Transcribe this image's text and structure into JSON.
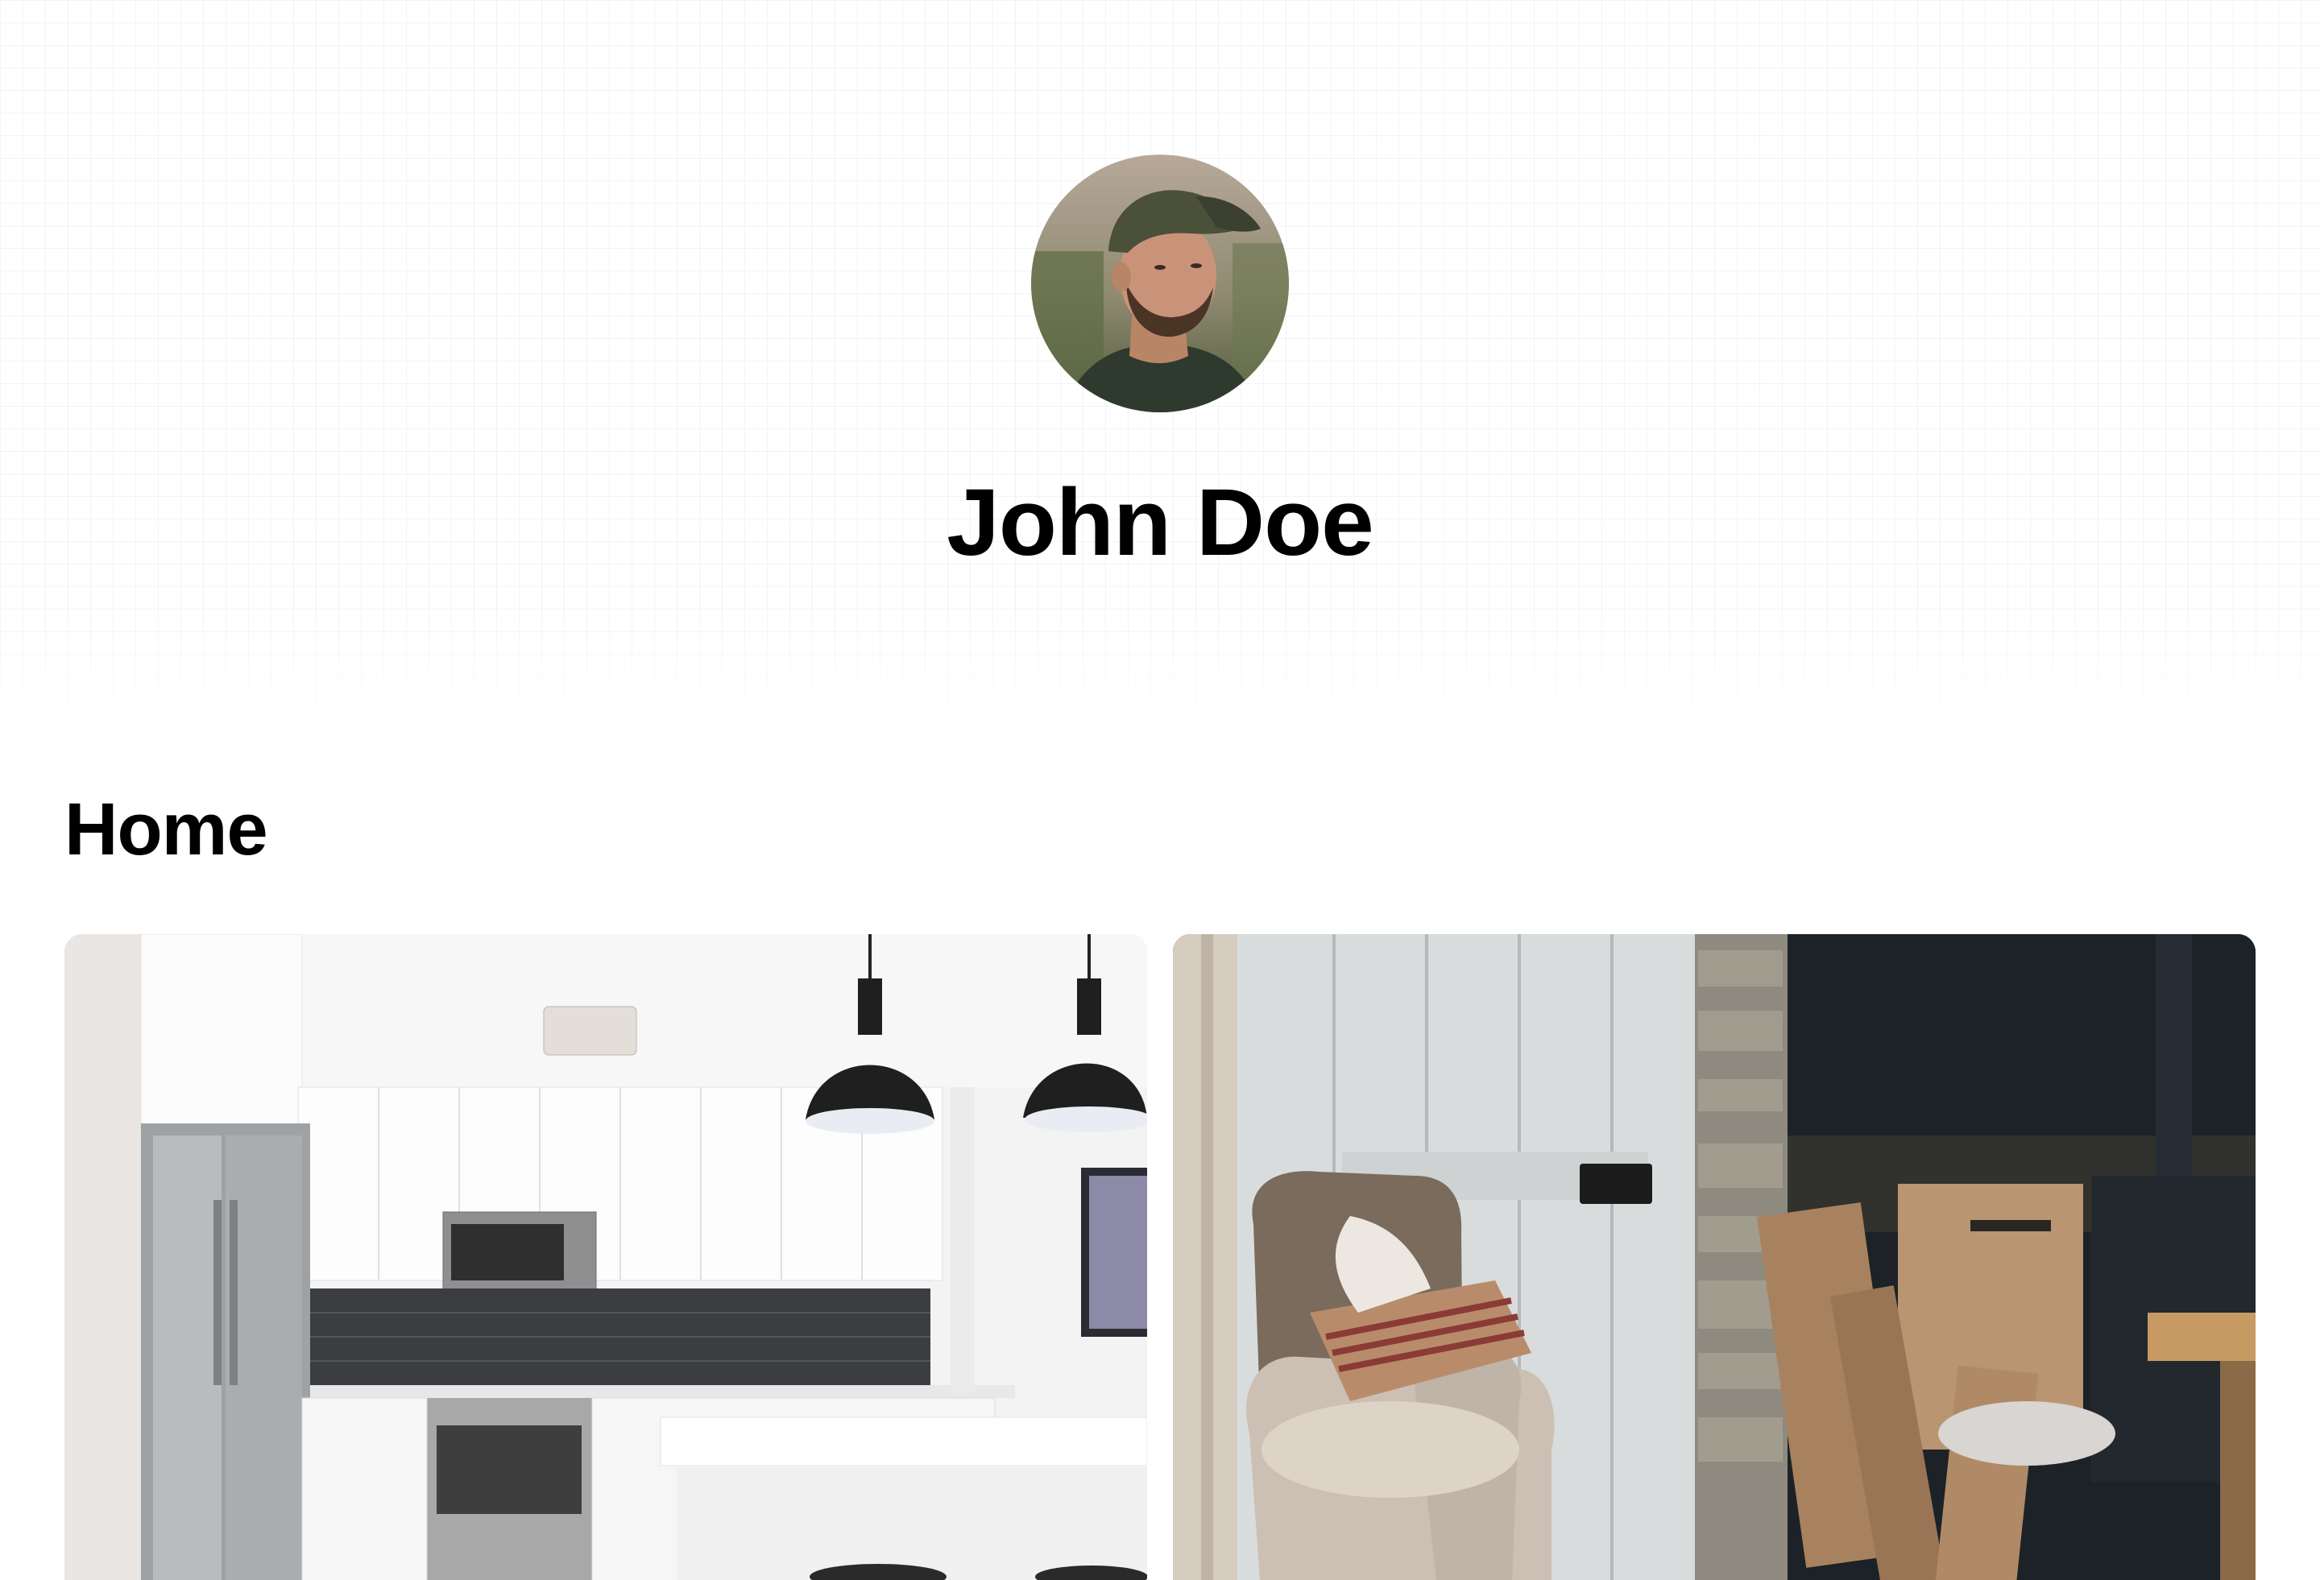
{
  "profile": {
    "name": "John Doe",
    "avatar_icon": "user-portrait"
  },
  "section": {
    "title": "Home"
  },
  "photos": [
    {
      "subject": "kitchen-photo",
      "tone": "#f2f2f2"
    },
    {
      "subject": "living-room-photo",
      "tone": "#1f252a"
    }
  ]
}
